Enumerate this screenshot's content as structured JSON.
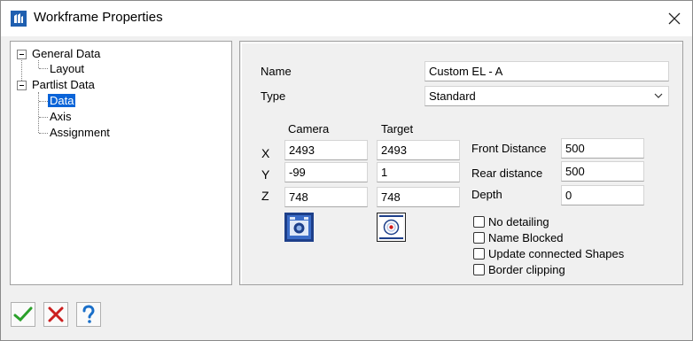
{
  "window": {
    "title": "Workframe Properties"
  },
  "tree": {
    "nodes": [
      {
        "label": "General Data"
      },
      {
        "label": "Layout"
      },
      {
        "label": "Partlist Data"
      },
      {
        "label": "Data"
      },
      {
        "label": "Axis"
      },
      {
        "label": "Assignment"
      }
    ],
    "selected": "Data"
  },
  "form": {
    "name_label": "Name",
    "name_value": "Custom EL - A",
    "type_label": "Type",
    "type_value": "Standard",
    "camera_header": "Camera",
    "target_header": "Target",
    "x_label": "X",
    "y_label": "Y",
    "z_label": "Z",
    "camera": {
      "x": "2493",
      "y": "-99",
      "z": "748"
    },
    "target": {
      "x": "2493",
      "y": "1",
      "z": "748"
    },
    "front_distance_label": "Front Distance",
    "front_distance_value": "500",
    "rear_distance_label": "Rear distance",
    "rear_distance_value": "500",
    "depth_label": "Depth",
    "depth_value": "0"
  },
  "options": [
    {
      "label": "No detailing",
      "checked": false
    },
    {
      "label": "Name Blocked",
      "checked": false
    },
    {
      "label": "Update connected Shapes",
      "checked": false
    },
    {
      "label": "Border clipping",
      "checked": false
    }
  ],
  "icons": {
    "app": "app-icon",
    "close": "close-icon",
    "camera_pick": "camera-pick-icon",
    "target_pick": "target-pick-icon",
    "ok": "checkmark-icon",
    "cancel": "cancel-x-icon",
    "help": "help-question-icon",
    "dropdown": "chevron-down-icon"
  },
  "colors": {
    "selection": "#0a64d8",
    "ok_green": "#2aa02a",
    "cancel_red": "#cc1f1f",
    "help_blue": "#1a6fc9",
    "camera_blue": "#1d3f8a"
  }
}
